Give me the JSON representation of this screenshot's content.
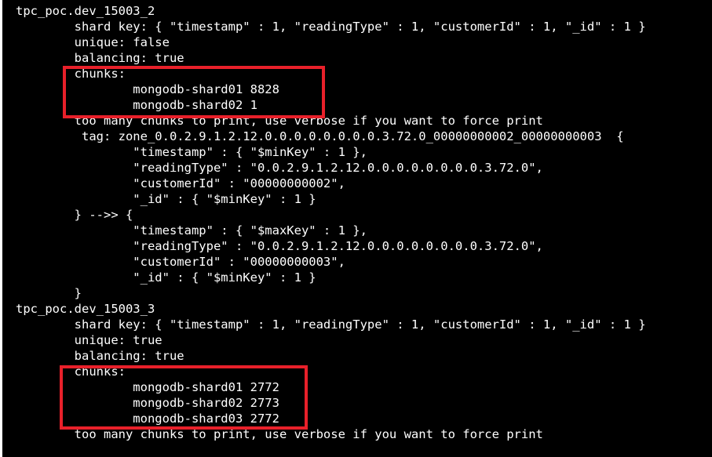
{
  "terminal": {
    "lines": [
      "tpc_poc.dev_15003_2",
      "        shard key: { \"timestamp\" : 1, \"readingType\" : 1, \"customerId\" : 1, \"_id\" : 1 }",
      "        unique: false",
      "        balancing: true",
      "        chunks:",
      "                mongodb-shard01 8828",
      "                mongodb-shard02 1",
      "        too many chunks to print, use verbose if you want to force print",
      "         tag: zone_0.0.2.9.1.2.12.0.0.0.0.0.0.0.0.3.72.0_00000000002_00000000003  {",
      "                \"timestamp\" : { \"$minKey\" : 1 },",
      "                \"readingType\" : \"0.0.2.9.1.2.12.0.0.0.0.0.0.0.0.3.72.0\",",
      "                \"customerId\" : \"00000000002\",",
      "                \"_id\" : { \"$minKey\" : 1 }",
      "        } -->> {",
      "                \"timestamp\" : { \"$maxKey\" : 1 },",
      "                \"readingType\" : \"0.0.2.9.1.2.12.0.0.0.0.0.0.0.0.3.72.0\",",
      "                \"customerId\" : \"00000000003\",",
      "                \"_id\" : { \"$minKey\" : 1 }",
      "        }",
      "tpc_poc.dev_15003_3",
      "        shard key: { \"timestamp\" : 1, \"readingType\" : 1, \"customerId\" : 1, \"_id\" : 1 }",
      "        unique: true",
      "        balancing: true",
      "        chunks:",
      "                mongodb-shard01 2772",
      "                mongodb-shard02 2773",
      "                mongodb-shard03 2772",
      "        too many chunks to print, use verbose if you want to force print"
    ]
  },
  "colors": {
    "background": "#000000",
    "text": "#ffffff",
    "highlight": "#e8202a"
  }
}
